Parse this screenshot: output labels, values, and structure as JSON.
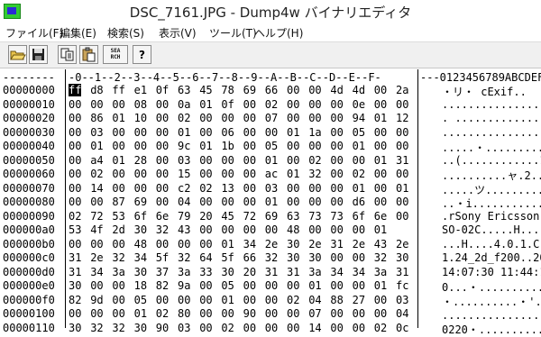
{
  "window": {
    "title": "DSC_7161.JPG - Dump4w バイナリエディタ",
    "icon": "app-icon"
  },
  "menu": [
    {
      "id": "file",
      "label": "ファイル(F)"
    },
    {
      "id": "edit",
      "label": "編集(E)"
    },
    {
      "id": "search",
      "label": "検索(S)"
    },
    {
      "id": "view",
      "label": "表示(V)"
    },
    {
      "id": "tools",
      "label": "ツール(T)"
    },
    {
      "id": "help",
      "label": "ヘルプ(H)"
    }
  ],
  "toolbar": {
    "open_icon": "folder-open-icon",
    "save_icon": "floppy-save-icon",
    "copy_icon": "copy-icon",
    "paste_icon": "paste-icon",
    "search_label_1": "SEA",
    "search_label_2": "RCH",
    "help_glyph": "?"
  },
  "hex_header": {
    "address_header": "--------",
    "byte_header": "-0--1--2--3--4--5--6--7--8--9--A--B--C--D--E--F-",
    "ascii_header": "---0123456789ABCDEF"
  },
  "rows": [
    {
      "addr": "00000000",
      "bytes": [
        "ff",
        "d8",
        "ff",
        "e1",
        "0f",
        "63",
        "45",
        "78",
        "69",
        "66",
        "00",
        "00",
        "4d",
        "4d",
        "00",
        "2a"
      ],
      "ascii": "・リ・ cExif.."
    },
    {
      "addr": "00000010",
      "bytes": [
        "00",
        "00",
        "00",
        "08",
        "00",
        "0a",
        "01",
        "0f",
        "00",
        "02",
        "00",
        "00",
        "00",
        "0e",
        "00",
        "00"
      ],
      "ascii": "................"
    },
    {
      "addr": "00000020",
      "bytes": [
        "00",
        "86",
        "01",
        "10",
        "00",
        "02",
        "00",
        "00",
        "00",
        "07",
        "00",
        "00",
        "00",
        "94",
        "01",
        "12"
      ],
      "ascii": ". ..............."
    },
    {
      "addr": "00000030",
      "bytes": [
        "00",
        "03",
        "00",
        "00",
        "00",
        "01",
        "00",
        "06",
        "00",
        "00",
        "01",
        "1a",
        "00",
        "05",
        "00",
        "00"
      ],
      "ascii": "................"
    },
    {
      "addr": "00000040",
      "bytes": [
        "00",
        "01",
        "00",
        "00",
        "00",
        "9c",
        "01",
        "1b",
        "00",
        "05",
        "00",
        "00",
        "00",
        "01",
        "00",
        "00"
      ],
      "ascii": ".....・.........."
    },
    {
      "addr": "00000050",
      "bytes": [
        "00",
        "a4",
        "01",
        "28",
        "00",
        "03",
        "00",
        "00",
        "00",
        "01",
        "00",
        "02",
        "00",
        "00",
        "01",
        "31"
      ],
      "ascii": "..(............1"
    },
    {
      "addr": "00000060",
      "bytes": [
        "00",
        "02",
        "00",
        "00",
        "00",
        "15",
        "00",
        "00",
        "00",
        "ac",
        "01",
        "32",
        "00",
        "02",
        "00",
        "00"
      ],
      "ascii": "..........ャ.2...."
    },
    {
      "addr": "00000070",
      "bytes": [
        "00",
        "14",
        "00",
        "00",
        "00",
        "c2",
        "02",
        "13",
        "00",
        "03",
        "00",
        "00",
        "00",
        "01",
        "00",
        "01"
      ],
      "ascii": ".....ツ.........."
    },
    {
      "addr": "00000080",
      "bytes": [
        "00",
        "00",
        "87",
        "69",
        "00",
        "04",
        "00",
        "00",
        "00",
        "01",
        "00",
        "00",
        "00",
        "d6",
        "00",
        "00"
      ],
      "ascii": "..・i...........ﾖ.."
    },
    {
      "addr": "00000090",
      "bytes": [
        "02",
        "72",
        "53",
        "6f",
        "6e",
        "79",
        "20",
        "45",
        "72",
        "69",
        "63",
        "73",
        "73",
        "6f",
        "6e",
        "00"
      ],
      "ascii": ".rSony Ericsson."
    },
    {
      "addr": "000000a0",
      "bytes": [
        "53",
        "4f",
        "2d",
        "30",
        "32",
        "43",
        "00",
        "00",
        "00",
        "00",
        "48",
        "00",
        "00",
        "00",
        "01"
      ],
      "ascii": "SO-02C.....H...."
    },
    {
      "addr": "000000b0",
      "bytes": [
        "00",
        "00",
        "00",
        "48",
        "00",
        "00",
        "00",
        "01",
        "34",
        "2e",
        "30",
        "2e",
        "31",
        "2e",
        "43",
        "2e"
      ],
      "ascii": "...H....4.0.1.C."
    },
    {
      "addr": "000000c0",
      "bytes": [
        "31",
        "2e",
        "32",
        "34",
        "5f",
        "32",
        "64",
        "5f",
        "66",
        "32",
        "30",
        "30",
        "00",
        "00",
        "32",
        "30"
      ],
      "ascii": "1.24_2d_f200..20"
    },
    {
      "addr": "000000d0",
      "bytes": [
        "31",
        "34",
        "3a",
        "30",
        "37",
        "3a",
        "33",
        "30",
        "20",
        "31",
        "31",
        "3a",
        "34",
        "34",
        "3a",
        "31"
      ],
      "ascii": "14:07:30 11:44:1"
    },
    {
      "addr": "000000e0",
      "bytes": [
        "30",
        "00",
        "00",
        "18",
        "82",
        "9a",
        "00",
        "05",
        "00",
        "00",
        "00",
        "01",
        "00",
        "00",
        "01",
        "fc"
      ],
      "ascii": "0...・.........."
    },
    {
      "addr": "000000f0",
      "bytes": [
        "82",
        "9d",
        "00",
        "05",
        "00",
        "00",
        "00",
        "01",
        "00",
        "00",
        "02",
        "04",
        "88",
        "27",
        "00",
        "03"
      ],
      "ascii": "・..........・'.."
    },
    {
      "addr": "00000100",
      "bytes": [
        "00",
        "00",
        "00",
        "01",
        "02",
        "80",
        "00",
        "00",
        "90",
        "00",
        "00",
        "07",
        "00",
        "00",
        "00",
        "04"
      ],
      "ascii": "...............・"
    },
    {
      "addr": "00000110",
      "bytes": [
        "30",
        "32",
        "32",
        "30",
        "90",
        "03",
        "00",
        "02",
        "00",
        "00",
        "00",
        "14",
        "00",
        "00",
        "02",
        "0c"
      ],
      "ascii": "0220・..........."
    }
  ],
  "colors": {
    "title_bg": "#ffffff",
    "toolbar_bg": "#f0f0f0",
    "cursor": "#000000"
  }
}
